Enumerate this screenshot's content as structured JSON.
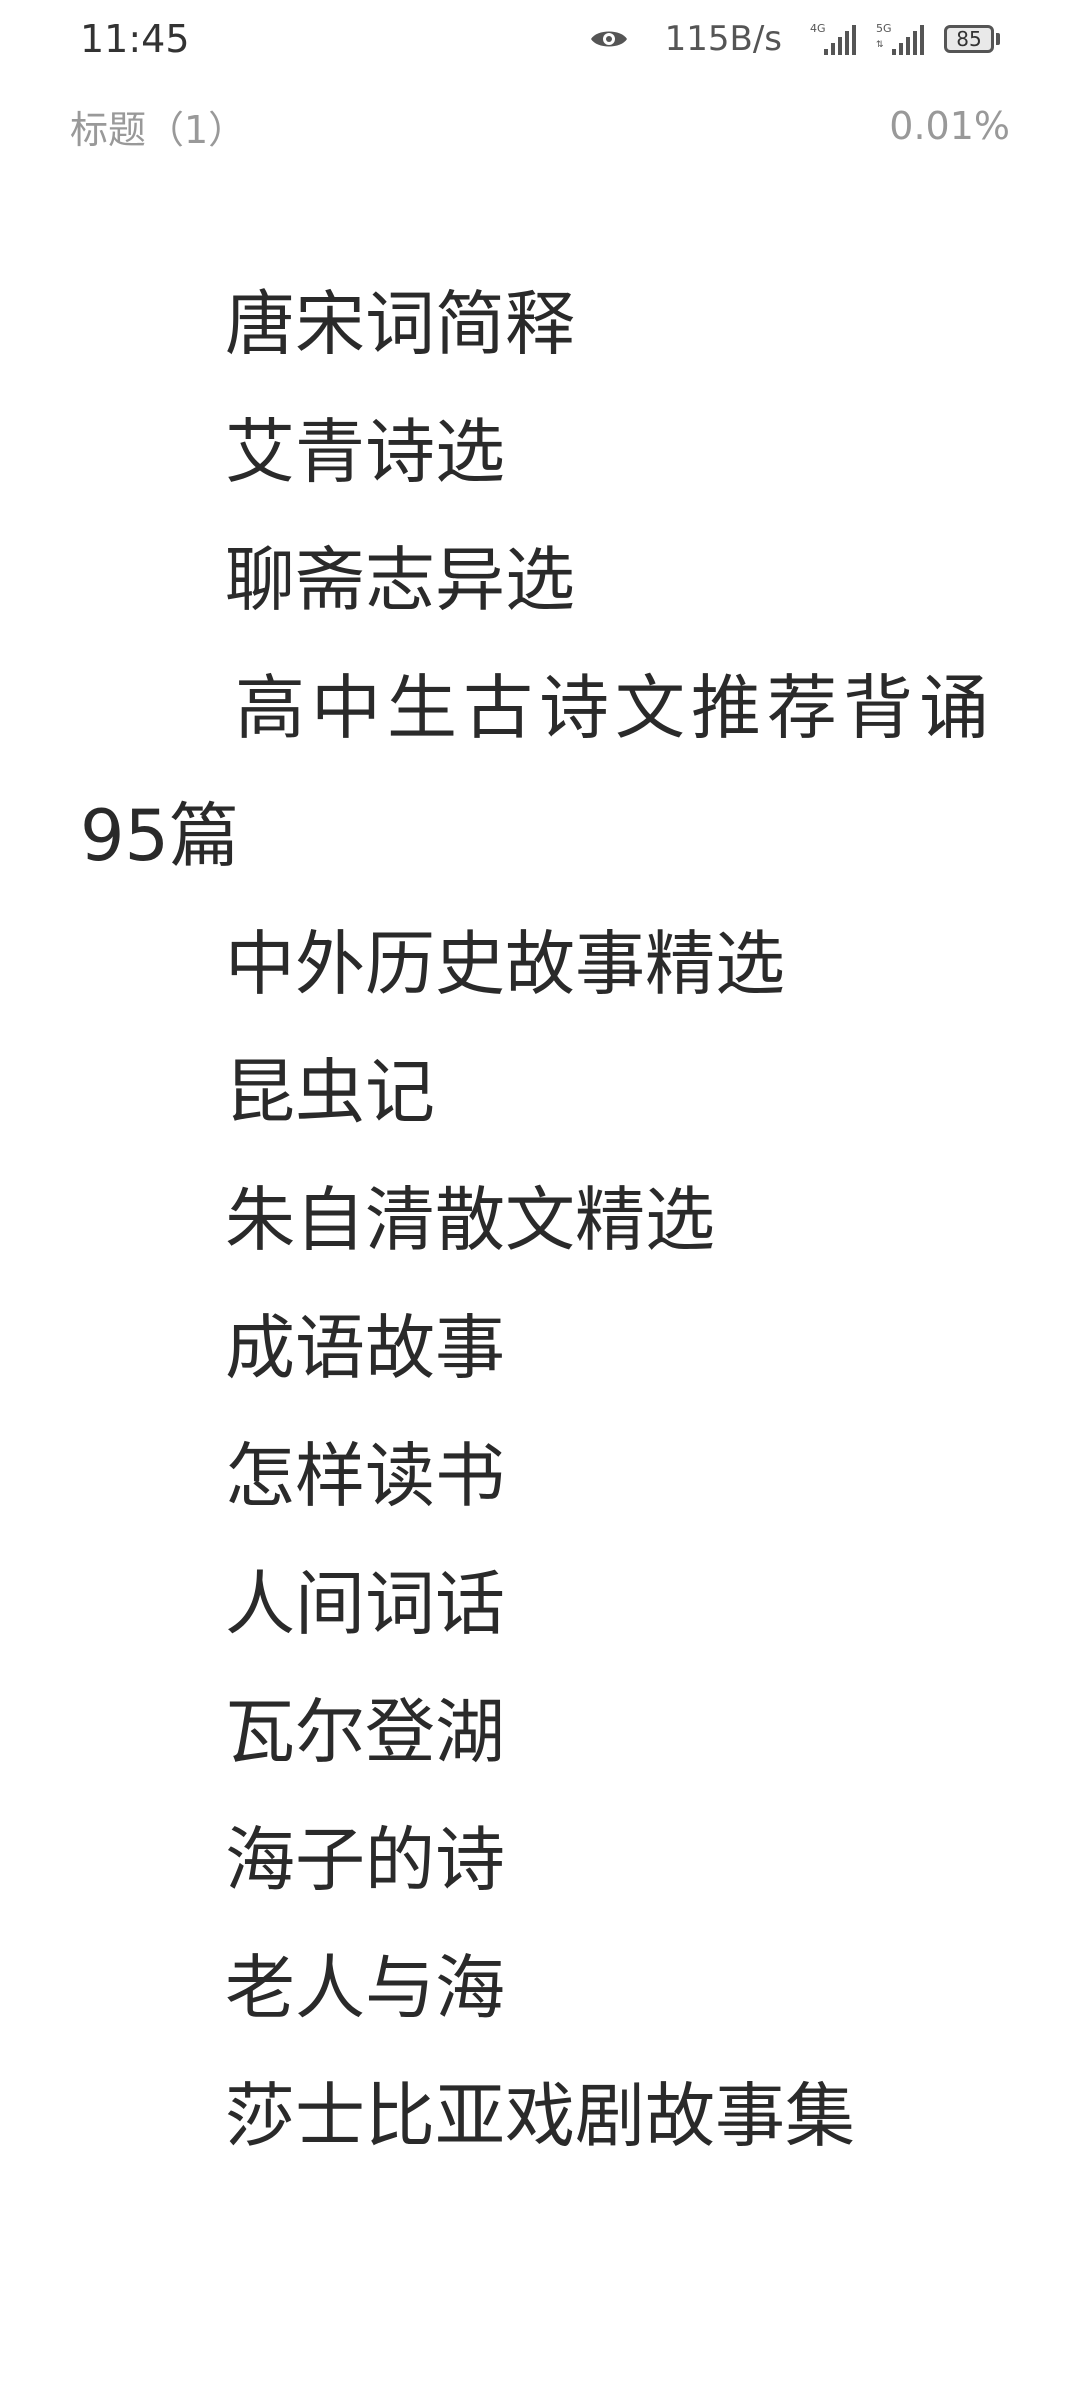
{
  "status_bar": {
    "time": "11:45",
    "net_speed": "115B/s",
    "signal_labels": [
      "4G",
      "5G"
    ],
    "battery": "85"
  },
  "reader": {
    "title": "标题（1）",
    "progress": "0.01%"
  },
  "content": {
    "lines": [
      "唐宋词简释",
      "艾青诗选",
      "聊斋志异选",
      "高中生古诗文推荐背诵",
      "95篇",
      "中外历史故事精选",
      "昆虫记",
      "朱自清散文精选",
      "成语故事",
      "怎样读书",
      "人间词话",
      "瓦尔登湖",
      "海子的诗",
      "老人与海",
      "莎士比亚戏剧故事集"
    ]
  }
}
